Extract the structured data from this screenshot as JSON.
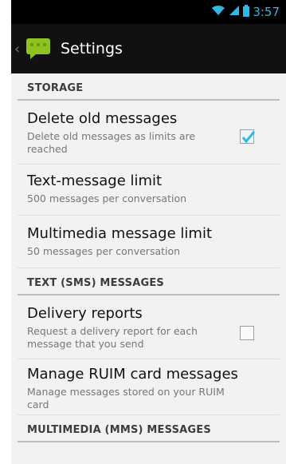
{
  "status_bar": {
    "time": "3:57",
    "icons": [
      "wifi-icon",
      "signal-icon",
      "battery-icon"
    ]
  },
  "action_bar": {
    "title": "Settings",
    "icon": "messaging-app-icon"
  },
  "sections": [
    {
      "header": "STORAGE",
      "items": [
        {
          "title": "Delete old messages",
          "summary": "Delete old messages as limits are reached",
          "checkbox": true,
          "checked": true
        },
        {
          "title": "Text-message limit",
          "summary": "500 messages per conversation"
        },
        {
          "title": "Multimedia message limit",
          "summary": "50 messages per conversation"
        }
      ]
    },
    {
      "header": "TEXT (SMS) MESSAGES",
      "items": [
        {
          "title": "Delivery reports",
          "summary": "Request a delivery report for each message that you send",
          "checkbox": true,
          "checked": false
        },
        {
          "title": "Manage RUIM card messages",
          "summary": "Manage messages stored on your RUIM card"
        }
      ]
    },
    {
      "header": "MULTIMEDIA (MMS) MESSAGES",
      "items": []
    }
  ],
  "colors": {
    "accent": "#33b5e5",
    "action_bar": "#111111",
    "background": "#f2f2f2",
    "app_icon": "#8ec21f"
  }
}
